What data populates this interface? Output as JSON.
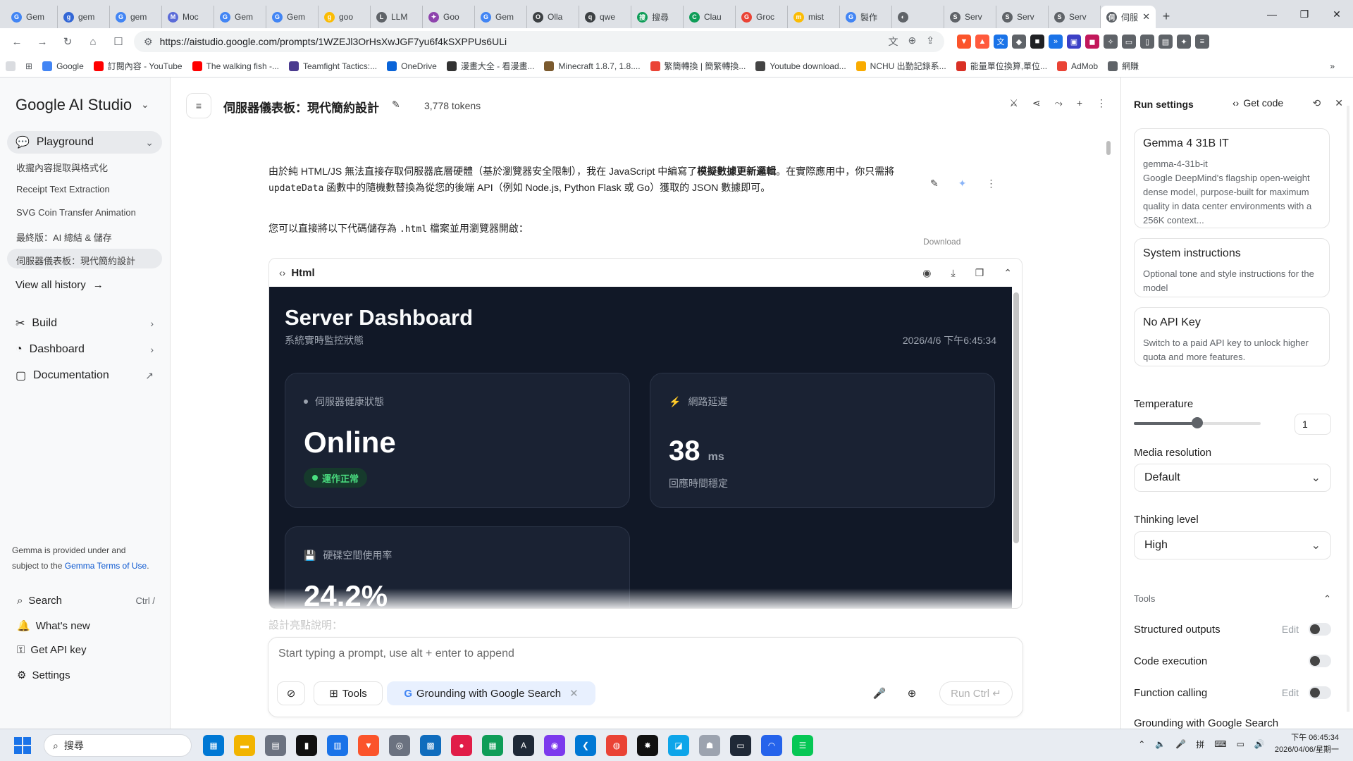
{
  "browser": {
    "tabs": [
      {
        "label": "Gem",
        "color": "#4285f4",
        "glyph": "G"
      },
      {
        "label": "gem",
        "color": "#3367d6",
        "glyph": "g"
      },
      {
        "label": "gem",
        "color": "#4285f4",
        "glyph": "G"
      },
      {
        "label": "Moc",
        "color": "#5b6bd8",
        "glyph": "M"
      },
      {
        "label": "Gem",
        "color": "#4285f4",
        "glyph": "G"
      },
      {
        "label": "Gem",
        "color": "#4285f4",
        "glyph": "G"
      },
      {
        "label": "goo",
        "color": "#fbbc04",
        "glyph": "g"
      },
      {
        "label": "LLM",
        "color": "#5f6368",
        "glyph": "L"
      },
      {
        "label": "Goo",
        "color": "#8e44ad",
        "glyph": "✦"
      },
      {
        "label": "Gem",
        "color": "#4285f4",
        "glyph": "G"
      },
      {
        "label": "Olla",
        "color": "#3c4043",
        "glyph": "O"
      },
      {
        "label": "qwe",
        "color": "#3c4043",
        "glyph": "q"
      },
      {
        "label": "搜尋",
        "color": "#0f9d58",
        "glyph": "搜"
      },
      {
        "label": "Clau",
        "color": "#0f9d58",
        "glyph": "C"
      },
      {
        "label": "Groc",
        "color": "#ea4335",
        "glyph": "G"
      },
      {
        "label": "mist",
        "color": "#fbbc04",
        "glyph": "m"
      },
      {
        "label": "製作",
        "color": "#4285f4",
        "glyph": "G"
      },
      {
        "label": "",
        "color": "#5f6368",
        "glyph": "◐"
      },
      {
        "label": "Serv",
        "color": "#5f6368",
        "glyph": "S"
      },
      {
        "label": "Serv",
        "color": "#5f6368",
        "glyph": "S"
      },
      {
        "label": "Serv",
        "color": "#5f6368",
        "glyph": "S"
      },
      {
        "label": "伺服",
        "color": "#5f6368",
        "glyph": "伺"
      }
    ],
    "url": "https://aistudio.google.com/prompts/1WZEJl3OrHsXwJGF7yu6f4kSXPPUs6ULi",
    "bookmarks": [
      {
        "label": "Google",
        "color": "#4285f4"
      },
      {
        "label": "訂閱內容 - YouTube",
        "color": "#ff0000"
      },
      {
        "label": "The walking fish -...",
        "color": "#ff0000"
      },
      {
        "label": "Teamfight Tactics:...",
        "color": "#4b3b8f"
      },
      {
        "label": "OneDrive",
        "color": "#0a64d8"
      },
      {
        "label": "漫畫大全 - 看漫畫...",
        "color": "#333333"
      },
      {
        "label": "Minecraft 1.8.7, 1.8....",
        "color": "#7b5a2e"
      },
      {
        "label": "繁簡轉換 | 簡繁轉換...",
        "color": "#ea4335"
      },
      {
        "label": "Youtube download...",
        "color": "#444444"
      },
      {
        "label": "NCHU 出勤記錄系...",
        "color": "#f9ab00"
      },
      {
        "label": "能量單位換算,單位...",
        "color": "#d93025"
      },
      {
        "label": "AdMob",
        "color": "#ea4335"
      },
      {
        "label": "網賺",
        "color": "#5f6368"
      }
    ]
  },
  "sidebar": {
    "brand": "Google AI Studio",
    "playground": "Playground",
    "history": [
      "收攏內容提取與格式化",
      "Receipt Text Extraction",
      "SVG Coin Transfer Animation",
      "最終版：AI 總結 & 儲存",
      "伺服器儀表板：現代簡約設計"
    ],
    "view_all": "View all history",
    "nav": [
      "Build",
      "Dashboard",
      "Documentation"
    ],
    "terms_prefix": "Gemma is provided under and subject to the",
    "terms_link": "Gemma Terms of Use",
    "terms_suffix": ".",
    "bottom": [
      {
        "label": "Search",
        "kbd": "Ctrl /"
      },
      {
        "label": "What's new",
        "kbd": ""
      },
      {
        "label": "Get API key",
        "kbd": ""
      },
      {
        "label": "Settings",
        "kbd": ""
      }
    ]
  },
  "header": {
    "title": "伺服器儀表板：現代簡約設計",
    "tokens": "3,778 tokens"
  },
  "response": {
    "p1a": "由於純 HTML/JS 無法直接存取伺服器底層硬體（基於瀏覽器安全限制），我在 JavaScript 中編寫了",
    "p1b": "模擬數據更新邏輯",
    "p1c": "。在實際應用中，你只需將",
    "p1code": "updateData",
    "p1d": "函數中的隨機數替換為從您的後端 API（例如 Node.js, Python Flask 或 Go）獲取的 JSON 數據即可。",
    "p2a": "您可以直接將以下代碼儲存為",
    "p2code": ".html",
    "p2b": "檔案並用瀏覽器開啟：",
    "download_tip": "Download",
    "code_lang": "Html",
    "faded_text": "設計亮點說明："
  },
  "preview": {
    "title": "Server Dashboard",
    "subtitle": "系統實時監控狀態",
    "time": "2026/4/6 下午6:45:34",
    "health_label": "伺服器健康狀態",
    "health_value": "Online",
    "health_pill": "運作正常",
    "latency_label": "網路延遲",
    "latency_value": "38",
    "latency_unit": "ms",
    "latency_note": "回應時間穩定",
    "disk_label": "硬碟空間使用率",
    "disk_value": "24.2%"
  },
  "prompt": {
    "placeholder": "Start typing a prompt, use alt + enter to append",
    "tools": "Tools",
    "grounding": "Grounding with Google Search",
    "run": "Run Ctrl ↵"
  },
  "run_settings": {
    "title": "Run settings",
    "get_code": "Get code",
    "model_name": "Gemma 4 31B IT",
    "model_id": "gemma-4-31b-it",
    "model_desc": "Google DeepMind's flagship open-weight dense model, purpose-built for maximum quality in data center environments with a 256K context...",
    "sys_title": "System instructions",
    "sys_desc": "Optional tone and style instructions for the model",
    "key_title": "No API Key",
    "key_desc": "Switch to a paid API key to unlock higher quota and more features.",
    "temperature_label": "Temperature",
    "temperature_value": "1",
    "temperature_fraction": 0.5,
    "media_label": "Media resolution",
    "media_value": "Default",
    "thinking_label": "Thinking level",
    "thinking_value": "High",
    "tools_header": "Tools",
    "tools": [
      {
        "label": "Structured outputs",
        "edit": "Edit"
      },
      {
        "label": "Code execution",
        "edit": ""
      },
      {
        "label": "Function calling",
        "edit": "Edit"
      },
      {
        "label": "Grounding with Google Search",
        "edit": ""
      }
    ]
  },
  "taskbar": {
    "search": "搜尋",
    "time": "下午 06:45:34",
    "date": "2026/04/06/星期一"
  }
}
